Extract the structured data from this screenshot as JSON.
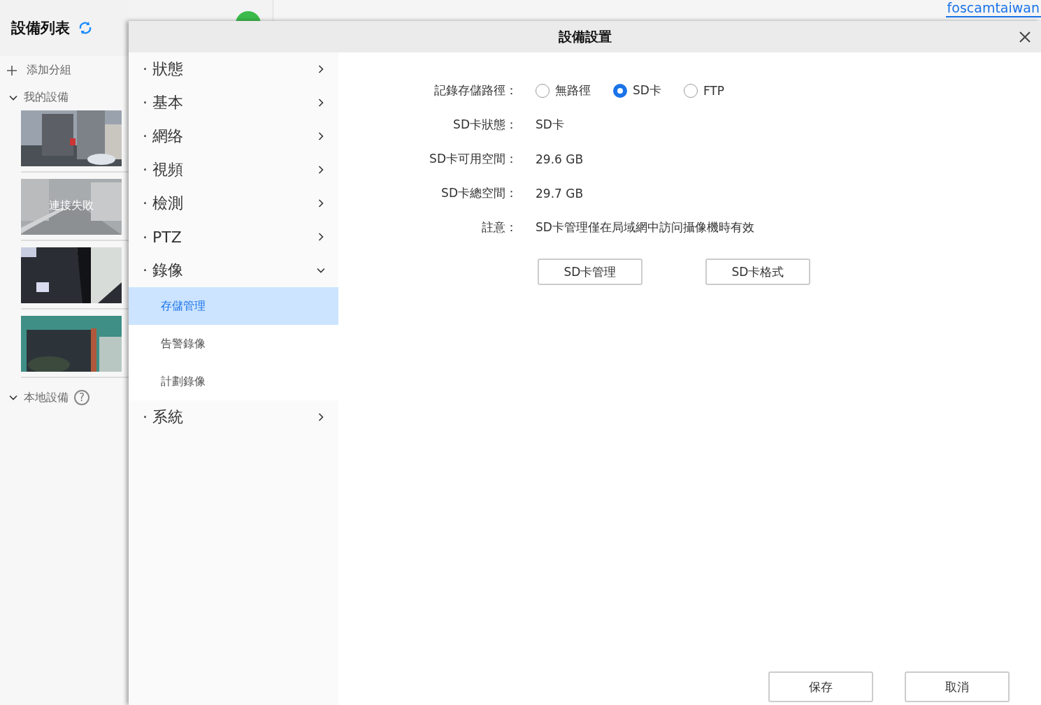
{
  "sidebar": {
    "title": "設備列表",
    "add_group": "添加分組",
    "groups": [
      {
        "label": "我的設備",
        "expanded": true,
        "devices": [
          {
            "kind": "picture"
          },
          {
            "kind": "picture",
            "overlay": "連接失敗"
          },
          {
            "kind": "picture"
          },
          {
            "kind": "picture"
          }
        ]
      },
      {
        "label": "本地設備",
        "expanded": true,
        "help": "?"
      }
    ]
  },
  "account": "foscamtaiwan",
  "dialog": {
    "title": "設備設置",
    "menu": [
      {
        "label": "· 狀態",
        "expanded": false
      },
      {
        "label": "· 基本",
        "expanded": false
      },
      {
        "label": "· 網络",
        "expanded": false
      },
      {
        "label": "· 視頻",
        "expanded": false
      },
      {
        "label": "· 檢測",
        "expanded": false
      },
      {
        "label": "· PTZ",
        "expanded": false
      },
      {
        "label": "· 錄像",
        "expanded": true,
        "children": [
          {
            "label": "存儲管理",
            "selected": true
          },
          {
            "label": "告警錄像",
            "selected": false
          },
          {
            "label": "計劃錄像",
            "selected": false
          }
        ]
      },
      {
        "label": "· 系統",
        "expanded": false
      }
    ],
    "form": [
      {
        "kind": "radio",
        "label": "記錄存儲路徑：",
        "options": [
          {
            "label": "無路徑",
            "selected": false
          },
          {
            "label": "SD卡",
            "selected": true
          },
          {
            "label": "FTP",
            "selected": false
          }
        ]
      },
      {
        "kind": "text",
        "label": "SD卡狀態：",
        "value": "SD卡"
      },
      {
        "kind": "text",
        "label": "SD卡可用空間：",
        "value": "29.6 GB"
      },
      {
        "kind": "text",
        "label": "SD卡總空間：",
        "value": "29.7 GB"
      },
      {
        "kind": "text",
        "label": "註意：",
        "value": "SD卡管理僅在局域網中訪问攝像機時有效"
      }
    ],
    "actions": [
      "SD卡管理",
      "SD卡格式"
    ],
    "footer": [
      "保存",
      "取消"
    ]
  }
}
